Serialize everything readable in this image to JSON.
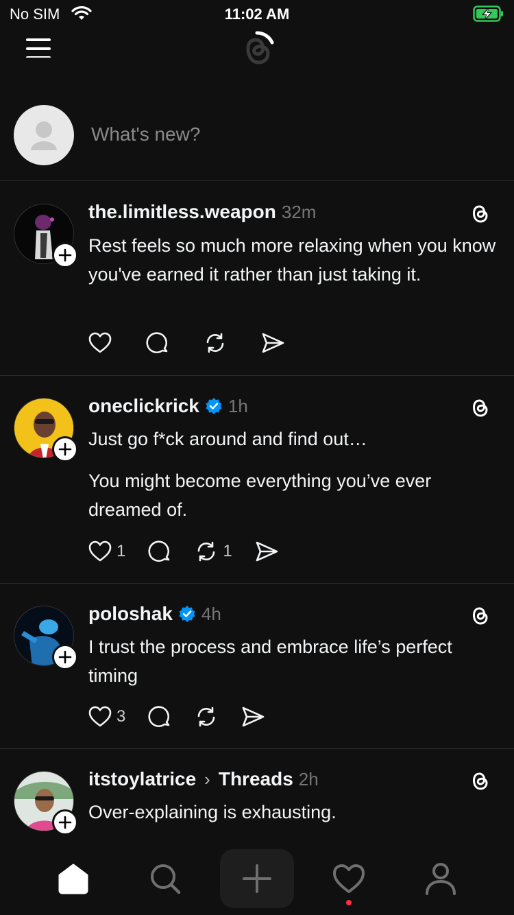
{
  "status_bar": {
    "carrier": "No SIM",
    "time": "11:02 AM",
    "battery_color": "#34c759"
  },
  "composer": {
    "placeholder": "What's new?"
  },
  "posts": [
    {
      "username": "the.limitless.weapon",
      "verified": false,
      "time": "32m",
      "paragraphs": [
        "Rest feels so much more relaxing when you know you've earned it rather than just taking it."
      ],
      "likes": "",
      "reposts": ""
    },
    {
      "username": "oneclickrick",
      "verified": true,
      "time": "1h",
      "paragraphs": [
        "Just go f*ck around and find out…",
        "You might become everything you’ve ever dreamed of."
      ],
      "likes": "1",
      "reposts": "1"
    },
    {
      "username": "poloshak",
      "verified": true,
      "time": "4h",
      "paragraphs": [
        "I trust the process and embrace life’s perfect timing"
      ],
      "likes": "3",
      "reposts": ""
    },
    {
      "username": "itstoylatrice",
      "verified": false,
      "topic": "Threads",
      "time": "2h",
      "paragraphs": [
        "Over-explaining is exhausting."
      ],
      "likes": "",
      "reposts": ""
    }
  ],
  "colors": {
    "verified": "#0095f6",
    "notification_dot": "#ff3040"
  },
  "tab_bar": {
    "icons": [
      "home-icon",
      "search-icon",
      "compose-icon",
      "activity-heart-icon",
      "profile-icon"
    ]
  }
}
